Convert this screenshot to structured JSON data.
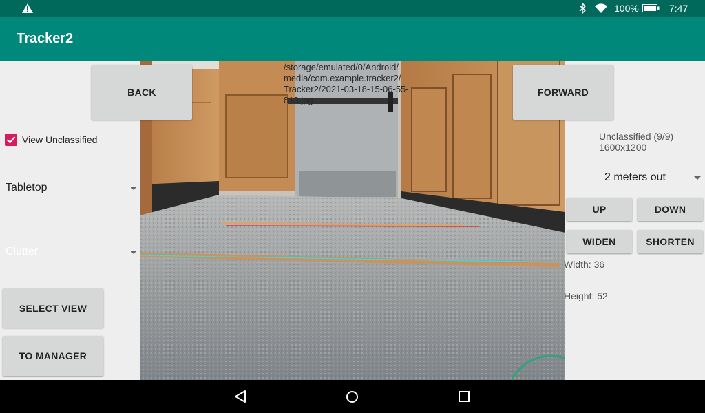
{
  "status_bar": {
    "battery_percent": "100%",
    "time": "7:47",
    "icons": [
      "warning-icon",
      "bluetooth-icon",
      "wifi-icon",
      "battery-icon"
    ]
  },
  "app_bar": {
    "title": "Tracker2"
  },
  "left_panel": {
    "back_label": "BACK",
    "view_unclassified": {
      "label": "View Unclassified",
      "checked": true
    },
    "category_spinner": {
      "value": "Tabletop"
    },
    "subcategory_spinner": {
      "value": "Clutter"
    },
    "select_view_label": "SELECT VIEW",
    "to_manager_label": "TO MANAGER"
  },
  "image_view": {
    "file_path": "/storage/emulated/0/Android/media/com.example.tracker2/Tracker2/2021-03-18-15-06-55-813.jpg",
    "file_path_lines": [
      "/storage/emulated/0/Android/",
      "media/com.example.tracker2/",
      "Tracker2/2021-03-18-15-06-55-",
      "813.jpg"
    ]
  },
  "right_panel": {
    "forward_label": "FORWARD",
    "classification_status": "Unclassified (9/9)",
    "resolution": "1600x1200",
    "distance_spinner": {
      "value": "2 meters out"
    },
    "up_label": "UP",
    "down_label": "DOWN",
    "widen_label": "WIDEN",
    "shorten_label": "SHORTEN",
    "width_text": "Width: 36",
    "height_text": "Height: 52"
  },
  "colors": {
    "status_bar": "#00695c",
    "app_bar": "#00897b",
    "checkbox_accent": "#d81b60",
    "marker_red": "#e03030",
    "marker_cyan": "#40d8e0"
  },
  "nav_bar": {
    "icons": [
      "back-nav-icon",
      "home-nav-icon",
      "recents-nav-icon"
    ]
  }
}
